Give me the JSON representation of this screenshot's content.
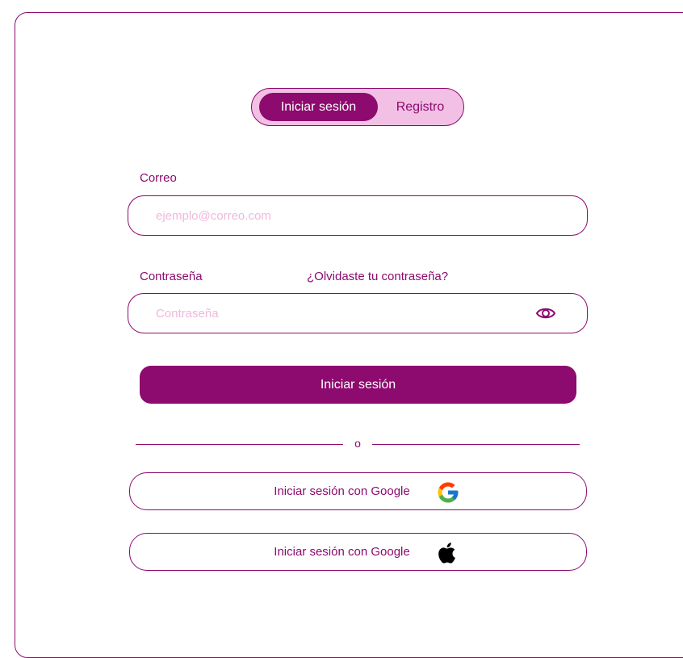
{
  "auth_toggle": {
    "login_label": "Iniciar sesión",
    "register_label": "Registro"
  },
  "email": {
    "label": "Correo",
    "placeholder": "ejemplo@correo.com",
    "value": ""
  },
  "password": {
    "label": "Contraseña",
    "forgot_link": "¿Olvidaste tu contraseña?",
    "placeholder": "Contraseña",
    "value": "",
    "toggle_icon": "eye-icon"
  },
  "submit": {
    "label": "Iniciar sesión"
  },
  "divider": {
    "text": "o"
  },
  "social": [
    {
      "label": "Iniciar sesión con Google",
      "icon": "google-icon"
    },
    {
      "label": "Iniciar sesión con Google",
      "icon": "apple-icon"
    }
  ],
  "colors": {
    "primary": "#8d0a6e",
    "toggle_bg": "#f1c0e4",
    "placeholder": "#efb8de"
  }
}
